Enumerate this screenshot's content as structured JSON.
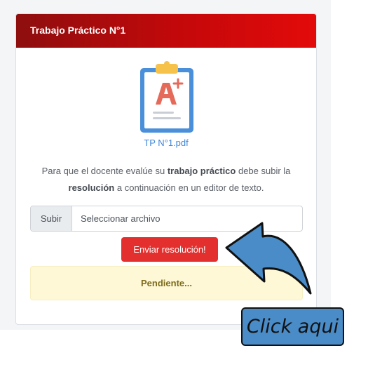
{
  "card": {
    "title": "Trabajo Práctico N°1",
    "file_name": "TP N°1.pdf",
    "file_icon": "clipboard-grade-a-icon"
  },
  "instructions": {
    "part1": "Para que el docente evalúe su ",
    "bold1": "trabajo práctico",
    "part2": " debe subir la ",
    "bold2": "resolución",
    "part3": " a continuación en un editor de texto."
  },
  "upload": {
    "button_label": "Subir",
    "field_text": "Seleccionar archivo"
  },
  "submit": {
    "label": "Enviar resolución!"
  },
  "status": {
    "text": "Pendiente..."
  },
  "annotation": {
    "label": "Click aqui",
    "arrow_icon": "curved-arrow-icon",
    "color": "#4a8cc7"
  },
  "colors": {
    "header_red": "#c4080a",
    "submit_red": "#e3302f",
    "status_bg": "#fff8d6",
    "link_blue": "#3f86d8"
  }
}
